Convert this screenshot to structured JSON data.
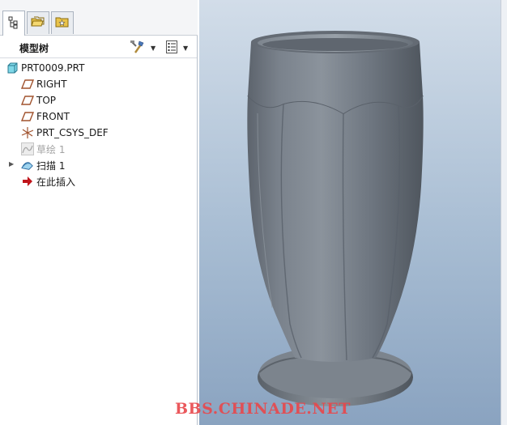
{
  "tabs": [
    {
      "icon": "model-tree-icon"
    },
    {
      "icon": "folder-browser-icon"
    },
    {
      "icon": "favorites-icon"
    }
  ],
  "tree_header": {
    "title": "模型树",
    "settings_icon": "tools-icon",
    "show_icon": "list-settings-icon"
  },
  "tree": {
    "items": [
      {
        "label": "PRT0009.PRT",
        "icon": "part-icon"
      },
      {
        "label": "RIGHT",
        "icon": "datum-plane-icon"
      },
      {
        "label": "TOP",
        "icon": "datum-plane-icon"
      },
      {
        "label": "FRONT",
        "icon": "datum-plane-icon"
      },
      {
        "label": "PRT_CSYS_DEF",
        "icon": "coordinate-system-icon"
      },
      {
        "label": "草绘 1",
        "icon": "sketch-icon"
      },
      {
        "label": "扫描 1",
        "icon": "sweep-icon"
      },
      {
        "label": "在此插入",
        "icon": "insert-here-arrow-icon"
      }
    ]
  },
  "colors": {
    "model": "#6a717a",
    "viewport_top": "#d2dde9",
    "viewport_bottom": "#8aa3c0",
    "datum": "#a0522d",
    "insert_arrow": "#c0141b"
  },
  "watermark": "BBS.CHINADE.NET"
}
